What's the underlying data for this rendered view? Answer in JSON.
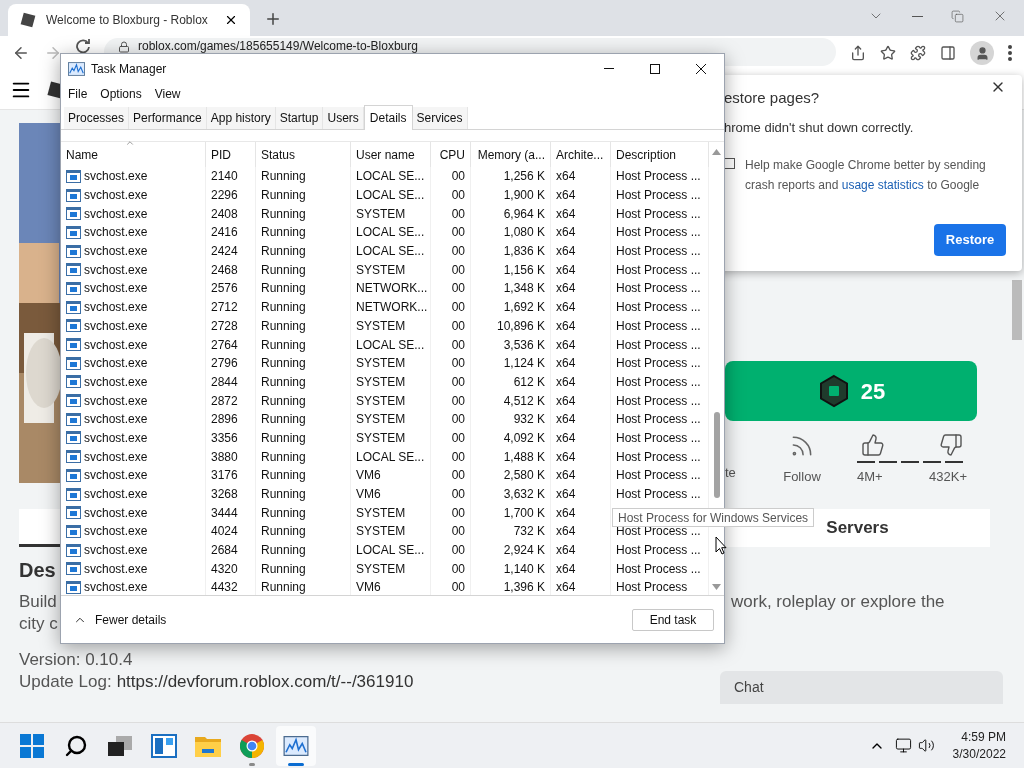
{
  "browser": {
    "tab_title": "Welcome to Bloxburg - Roblox",
    "url": "roblox.com/games/185655149/Welcome-to-Bloxburg"
  },
  "page": {
    "price": "25",
    "favorite_label": "te",
    "follow_label": "Follow",
    "likes": "4M+",
    "dislikes": "432K+",
    "servers_tab": "Servers",
    "heading": "Des",
    "description_left": [
      "Build",
      "city c"
    ],
    "description_right": "work, roleplay or explore the",
    "version": "Version: 0.10.4",
    "update_log_label": "Update Log:",
    "update_log_link": "https://devforum.roblox.com/t/--/361910",
    "chat": "Chat"
  },
  "restore_dialog": {
    "title": "estore pages?",
    "message": "hrome didn't shut down correctly.",
    "checkbox": {
      "checked": false,
      "text_before": "Help make Google Chrome better by sending crash reports and",
      "link": "usage statistics",
      "text_after": "to Google"
    },
    "button": "Restore"
  },
  "task_manager": {
    "title": "Task Manager",
    "menu": [
      "File",
      "Options",
      "View"
    ],
    "tabs": [
      {
        "label": "Processes",
        "selected": false
      },
      {
        "label": "Performance",
        "selected": false
      },
      {
        "label": "App history",
        "selected": false
      },
      {
        "label": "Startup",
        "selected": false
      },
      {
        "label": "Users",
        "selected": false
      },
      {
        "label": "Details",
        "selected": true
      },
      {
        "label": "Services",
        "selected": false
      }
    ],
    "columns": [
      "Name",
      "PID",
      "Status",
      "User name",
      "CPU",
      "Memory (a...",
      "Archite...",
      "Description"
    ],
    "rows": [
      {
        "name": "svchost.exe",
        "pid": "2140",
        "status": "Running",
        "user": "LOCAL SE...",
        "cpu": "00",
        "memory": "1,256 K",
        "arch": "x64",
        "description": "Host Process ..."
      },
      {
        "name": "svchost.exe",
        "pid": "2296",
        "status": "Running",
        "user": "LOCAL SE...",
        "cpu": "00",
        "memory": "1,900 K",
        "arch": "x64",
        "description": "Host Process ..."
      },
      {
        "name": "svchost.exe",
        "pid": "2408",
        "status": "Running",
        "user": "SYSTEM",
        "cpu": "00",
        "memory": "6,964 K",
        "arch": "x64",
        "description": "Host Process ..."
      },
      {
        "name": "svchost.exe",
        "pid": "2416",
        "status": "Running",
        "user": "LOCAL SE...",
        "cpu": "00",
        "memory": "1,080 K",
        "arch": "x64",
        "description": "Host Process ..."
      },
      {
        "name": "svchost.exe",
        "pid": "2424",
        "status": "Running",
        "user": "LOCAL SE...",
        "cpu": "00",
        "memory": "1,836 K",
        "arch": "x64",
        "description": "Host Process ..."
      },
      {
        "name": "svchost.exe",
        "pid": "2468",
        "status": "Running",
        "user": "SYSTEM",
        "cpu": "00",
        "memory": "1,156 K",
        "arch": "x64",
        "description": "Host Process ..."
      },
      {
        "name": "svchost.exe",
        "pid": "2576",
        "status": "Running",
        "user": "NETWORK...",
        "cpu": "00",
        "memory": "1,348 K",
        "arch": "x64",
        "description": "Host Process ..."
      },
      {
        "name": "svchost.exe",
        "pid": "2712",
        "status": "Running",
        "user": "NETWORK...",
        "cpu": "00",
        "memory": "1,692 K",
        "arch": "x64",
        "description": "Host Process ..."
      },
      {
        "name": "svchost.exe",
        "pid": "2728",
        "status": "Running",
        "user": "SYSTEM",
        "cpu": "00",
        "memory": "10,896 K",
        "arch": "x64",
        "description": "Host Process ..."
      },
      {
        "name": "svchost.exe",
        "pid": "2764",
        "status": "Running",
        "user": "LOCAL SE...",
        "cpu": "00",
        "memory": "3,536 K",
        "arch": "x64",
        "description": "Host Process ..."
      },
      {
        "name": "svchost.exe",
        "pid": "2796",
        "status": "Running",
        "user": "SYSTEM",
        "cpu": "00",
        "memory": "1,124 K",
        "arch": "x64",
        "description": "Host Process ..."
      },
      {
        "name": "svchost.exe",
        "pid": "2844",
        "status": "Running",
        "user": "SYSTEM",
        "cpu": "00",
        "memory": "612 K",
        "arch": "x64",
        "description": "Host Process ..."
      },
      {
        "name": "svchost.exe",
        "pid": "2872",
        "status": "Running",
        "user": "SYSTEM",
        "cpu": "00",
        "memory": "4,512 K",
        "arch": "x64",
        "description": "Host Process ..."
      },
      {
        "name": "svchost.exe",
        "pid": "2896",
        "status": "Running",
        "user": "SYSTEM",
        "cpu": "00",
        "memory": "932 K",
        "arch": "x64",
        "description": "Host Process ..."
      },
      {
        "name": "svchost.exe",
        "pid": "3356",
        "status": "Running",
        "user": "SYSTEM",
        "cpu": "00",
        "memory": "4,092 K",
        "arch": "x64",
        "description": "Host Process ..."
      },
      {
        "name": "svchost.exe",
        "pid": "3880",
        "status": "Running",
        "user": "LOCAL SE...",
        "cpu": "00",
        "memory": "1,488 K",
        "arch": "x64",
        "description": "Host Process ..."
      },
      {
        "name": "svchost.exe",
        "pid": "3176",
        "status": "Running",
        "user": "VM6",
        "cpu": "00",
        "memory": "2,580 K",
        "arch": "x64",
        "description": "Host Process ..."
      },
      {
        "name": "svchost.exe",
        "pid": "3268",
        "status": "Running",
        "user": "VM6",
        "cpu": "00",
        "memory": "3,632 K",
        "arch": "x64",
        "description": "Host Process ..."
      },
      {
        "name": "svchost.exe",
        "pid": "3444",
        "status": "Running",
        "user": "SYSTEM",
        "cpu": "00",
        "memory": "1,700 K",
        "arch": "x64"
      },
      {
        "name": "svchost.exe",
        "pid": "4024",
        "status": "Running",
        "user": "SYSTEM",
        "cpu": "00",
        "memory": "732 K",
        "arch": "x64",
        "description": "Host Process ..."
      },
      {
        "name": "svchost.exe",
        "pid": "2684",
        "status": "Running",
        "user": "LOCAL SE...",
        "cpu": "00",
        "memory": "2,924 K",
        "arch": "x64",
        "description": "Host Process ..."
      },
      {
        "name": "svchost.exe",
        "pid": "4320",
        "status": "Running",
        "user": "SYSTEM",
        "cpu": "00",
        "memory": "1,140 K",
        "arch": "x64",
        "description": "Host Process ..."
      },
      {
        "name": "svchost.exe",
        "pid": "4432",
        "status": "Running",
        "user": "VM6",
        "cpu": "00",
        "memory": "1,396 K",
        "arch": "x64",
        "description": "Host Process"
      }
    ],
    "tooltip": "Host Process for Windows Services",
    "fewer_details": "Fewer details",
    "end_task": "End task"
  },
  "taskbar": {
    "apps": [
      {
        "kind": "start",
        "running": false,
        "active": false
      },
      {
        "kind": "search",
        "running": false,
        "active": false
      },
      {
        "kind": "task-view",
        "running": false,
        "active": false
      },
      {
        "kind": "widgets",
        "running": false,
        "active": false
      },
      {
        "kind": "explorer",
        "running": false,
        "active": false
      },
      {
        "kind": "chrome",
        "running": true,
        "active": false
      },
      {
        "kind": "task-manager",
        "running": true,
        "active": true
      }
    ],
    "time": "4:59 PM",
    "date": "3/30/2022"
  }
}
